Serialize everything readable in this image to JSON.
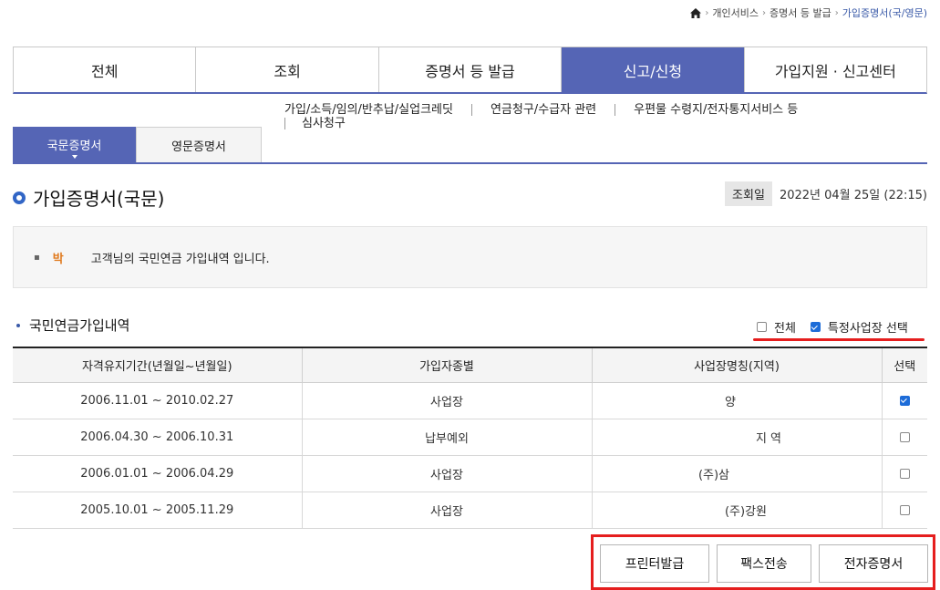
{
  "breadcrumb": {
    "items": [
      "개인서비스",
      "증명서 등 발급",
      "가입증명서(국/영문)"
    ]
  },
  "main_tabs": [
    {
      "label": "전체",
      "active": false
    },
    {
      "label": "조회",
      "active": false
    },
    {
      "label": "증명서 등 발급",
      "active": false
    },
    {
      "label": "신고/신청",
      "active": true
    },
    {
      "label": "가입지원 · 신고센터",
      "active": false
    }
  ],
  "sub_nav": {
    "items": [
      "가입/소득/임의/반추납/실업크레딧",
      "연금청구/수급자 관련",
      "우편물 수령지/전자통지서비스 등",
      "심사청구"
    ]
  },
  "doc_tabs": {
    "korean": "국문증명서",
    "english": "영문증명서"
  },
  "page": {
    "title": "가입증명서(국문)"
  },
  "lookup": {
    "badge": "조회일",
    "date": "2022년 04월 25일 (22:15)"
  },
  "info": {
    "name": "박",
    "message": "고객님의 국민연금 가입내역 입니다."
  },
  "section": {
    "title": "국민연금가입내역"
  },
  "filter": {
    "all_label": "전체",
    "specific_label": "특정사업장 선택",
    "all_checked": false,
    "specific_checked": true
  },
  "table": {
    "headers": [
      "자격유지기간(년월일~년월일)",
      "가입자종별",
      "사업장명칭(지역)",
      "선택"
    ],
    "rows": [
      {
        "period": "2006.11.01 ~ 2010.02.27",
        "type": "사업장",
        "workplace": "양",
        "selected": true
      },
      {
        "period": "2006.04.30 ~ 2006.10.31",
        "type": "납부예외",
        "workplace": "지 역",
        "selected": false
      },
      {
        "period": "2006.01.01 ~ 2006.04.29",
        "type": "사업장",
        "workplace": "(주)삼",
        "selected": false
      },
      {
        "period": "2005.10.01 ~ 2005.11.29",
        "type": "사업장",
        "workplace": "(주)강원",
        "selected": false
      }
    ]
  },
  "buttons": {
    "print": "프린터발급",
    "fax": "팩스전송",
    "electronic": "전자증명서"
  },
  "colors": {
    "accent": "#5565b5",
    "highlight_red": "#e51e1e",
    "name_orange": "#e07a1e"
  }
}
